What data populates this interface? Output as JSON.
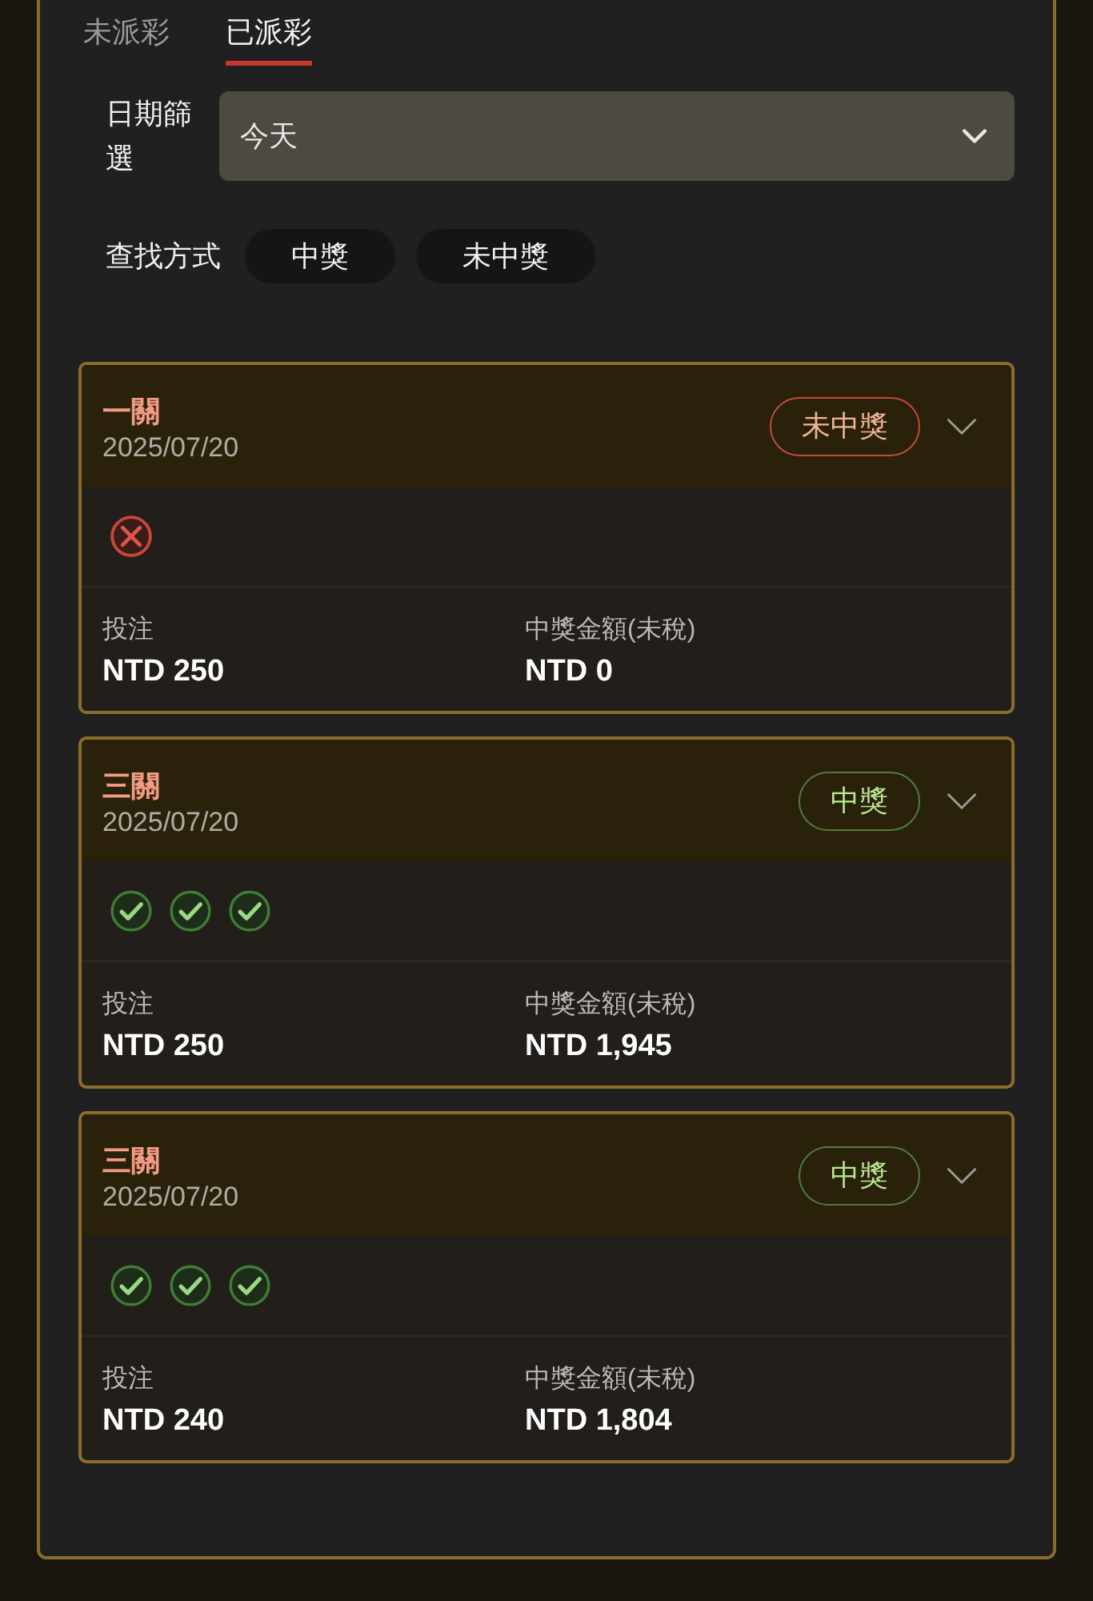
{
  "tabs": [
    {
      "label": "未派彩",
      "selected": false
    },
    {
      "label": "已派彩",
      "selected": true
    }
  ],
  "date_filter": {
    "label": "日期篩選",
    "value": "今天"
  },
  "search": {
    "label": "查找方式",
    "options": [
      {
        "label": "中獎",
        "selected": false
      },
      {
        "label": "未中獎",
        "selected": false
      }
    ]
  },
  "bets": [
    {
      "title": "一關",
      "date": "2025/07/20",
      "status": "未中獎",
      "won": false,
      "legs": [
        {
          "kind": "miss"
        }
      ],
      "stake_label": "投注",
      "stake": "NTD 250",
      "payout_label": "中獎金額(未稅)",
      "payout": "NTD 0"
    },
    {
      "title": "三關",
      "date": "2025/07/20",
      "status": "中獎",
      "won": true,
      "legs": [
        {
          "kind": "hit"
        },
        {
          "kind": "hit"
        },
        {
          "kind": "hit"
        }
      ],
      "stake_label": "投注",
      "stake": "NTD 250",
      "payout_label": "中獎金額(未稅)",
      "payout": "NTD 1,945"
    },
    {
      "title": "三關",
      "date": "2025/07/20",
      "status": "中獎",
      "won": true,
      "legs": [
        {
          "kind": "hit"
        },
        {
          "kind": "hit"
        },
        {
          "kind": "hit"
        }
      ],
      "stake_label": "投注",
      "stake": "NTD 240",
      "payout_label": "中獎金額(未稅)",
      "payout": "NTD 1,804"
    }
  ]
}
